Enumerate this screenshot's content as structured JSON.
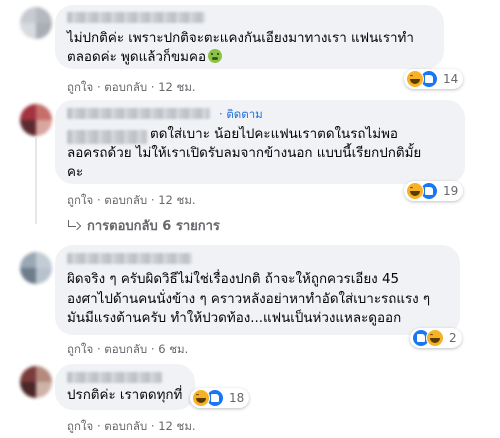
{
  "comments": [
    {
      "line1": "ไม่ปกติค่ะ เพราะปกติจะตะแคงกันเอียงมาทางเรา แฟนเราทำ",
      "line2": "ตลอดค่ะ พูดแล้วก็ขมคอ",
      "line2_emoji": "sick-face-emoji",
      "like_label": "ถูกใจ",
      "reply_label": "ตอบกลับ",
      "time": "12 ชม.",
      "reaction_count": "14",
      "avatar_colors": [
        "#c7cbd1",
        "#b4b9c0",
        "#d7dadf",
        "#a9aeb5"
      ]
    },
    {
      "follow_label": "ติดตาม",
      "line1": "ตดใส่เบาะ น้อยไปคะแฟนเราตดในรถไม่พอ",
      "line2": "ลอครถด้วย ไม่ให้เราเปิดรับลมจากข้างนอก แบบนี้เรียกปกติมั้ย",
      "line3": "คะ",
      "like_label": "ถูกใจ",
      "reply_label": "ตอบกลับ",
      "time": "12 ชม.",
      "reaction_count": "19",
      "replies_label": "การตอบกลับ 6 รายการ",
      "avatar_colors": [
        "#a2333f",
        "#c76e6a",
        "#5c2a2e",
        "#d9a5a0"
      ]
    },
    {
      "line1": "ผิดจริง ๆ ครับผิดวิธีไม่ใช่เรื่องปกติ ถ้าจะให้ถูกควรเอียง 45",
      "line2": "องศาไปด้านคนนั่งข้าง ๆ คราวหลังอย่าหาทำอัดใส่เบาะรถแรง ๆ",
      "line3": "มันมีแรงต้านครับ ทำให้ปวดท้อง...แฟนเป็นห่วงแหละดูออก",
      "like_label": "ถูกใจ",
      "reply_label": "ตอบกลับ",
      "time": "6 ชม.",
      "reaction_count": "2",
      "avatar_colors": [
        "#9aa7b5",
        "#c3ccd5",
        "#6d7d8c",
        "#b8c2cc"
      ]
    },
    {
      "line1": "ปรกติค่ะ เราตดทุกที่",
      "like_label": "ถูกใจ",
      "reply_label": "ตอบกลับ",
      "time": "12 ชม.",
      "reaction_count": "18",
      "avatar_colors": [
        "#7a3b3b",
        "#b58a7d",
        "#4a2626",
        "#d0b3a8"
      ]
    }
  ],
  "colors": {
    "bubble": "#f0f2f5",
    "meta_text": "#65676b",
    "follow_link": "#216fdb",
    "like_blue": "#1877f2",
    "haha_yellow": "#f7b125"
  }
}
